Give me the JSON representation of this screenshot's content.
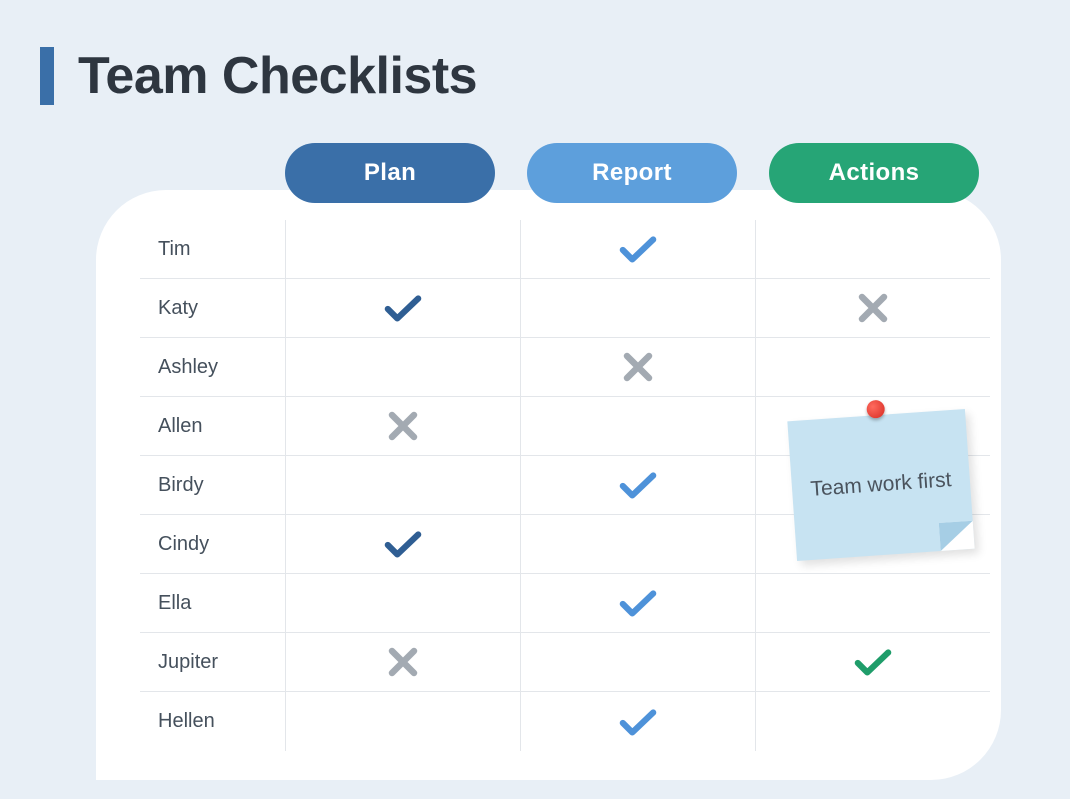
{
  "title": "Team Checklists",
  "columns": [
    "Plan",
    "Report",
    "Actions"
  ],
  "rows": [
    {
      "name": "Tim",
      "cells": [
        "",
        "check-blue",
        ""
      ]
    },
    {
      "name": "Katy",
      "cells": [
        "check-dark",
        "",
        "cross"
      ]
    },
    {
      "name": "Ashley",
      "cells": [
        "",
        "cross",
        ""
      ]
    },
    {
      "name": "Allen",
      "cells": [
        "cross",
        "",
        ""
      ]
    },
    {
      "name": "Birdy",
      "cells": [
        "",
        "check-blue",
        ""
      ]
    },
    {
      "name": "Cindy",
      "cells": [
        "check-dark",
        "",
        ""
      ]
    },
    {
      "name": "Ella",
      "cells": [
        "",
        "check-blue",
        ""
      ]
    },
    {
      "name": "Jupiter",
      "cells": [
        "cross",
        "",
        "check-green"
      ]
    },
    {
      "name": "Hellen",
      "cells": [
        "",
        "check-blue",
        ""
      ]
    }
  ],
  "note": "Team work first",
  "colors": {
    "plan": "#3a6fa8",
    "report": "#5d9fdc",
    "actions": "#26a576",
    "cross": "#a3aab2",
    "check_dark": "#2f5e93",
    "check_blue": "#4e92d9",
    "check_green": "#1f9d6a"
  }
}
